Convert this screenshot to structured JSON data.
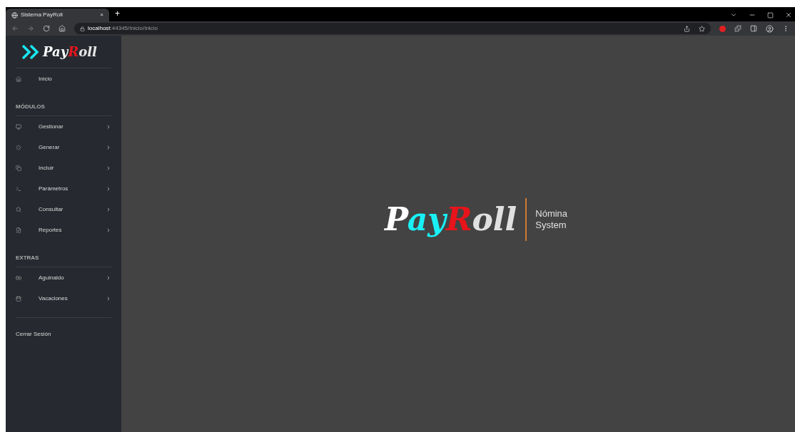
{
  "browser": {
    "tab_title": "Sistema PayRoll",
    "tab_close": "×",
    "new_tab": "+",
    "url_host": "localhost",
    "url_path": ":44345/Inicio/Inicio"
  },
  "sidebar": {
    "logo": [
      {
        "text": "P",
        "color": "#ffffff"
      },
      {
        "text": "ay",
        "color": "#ffffff"
      },
      {
        "text": "R",
        "color": "#e8141b"
      },
      {
        "text": "oll",
        "color": "#e5e5e5"
      }
    ],
    "sections": [
      {
        "items": [
          {
            "label": "Inicio",
            "kind": "link"
          }
        ]
      },
      {
        "heading": "MÓDULOS",
        "items": [
          {
            "label": "Gestionar",
            "kind": "submenu"
          },
          {
            "label": "Generar",
            "kind": "submenu"
          },
          {
            "label": "Incluir",
            "kind": "submenu"
          },
          {
            "label": "Parámetros",
            "kind": "submenu"
          },
          {
            "label": "Consultar",
            "kind": "submenu"
          },
          {
            "label": "Reportes",
            "kind": "submenu"
          }
        ]
      },
      {
        "heading": "EXTRAS",
        "items": [
          {
            "label": "Aguinaldo",
            "kind": "submenu"
          },
          {
            "label": "Vacaciones",
            "kind": "submenu"
          }
        ]
      }
    ],
    "logout": "Cerrar Sesión"
  },
  "main": {
    "logo": [
      {
        "text": "P",
        "color": "#ffffff"
      },
      {
        "text": "ay",
        "color": "#19f0f5"
      },
      {
        "text": "R",
        "color": "#e8141b"
      },
      {
        "text": "oll",
        "color": "#e0e0e0"
      }
    ],
    "subtitle_lines": [
      "Nómina",
      "System"
    ]
  }
}
